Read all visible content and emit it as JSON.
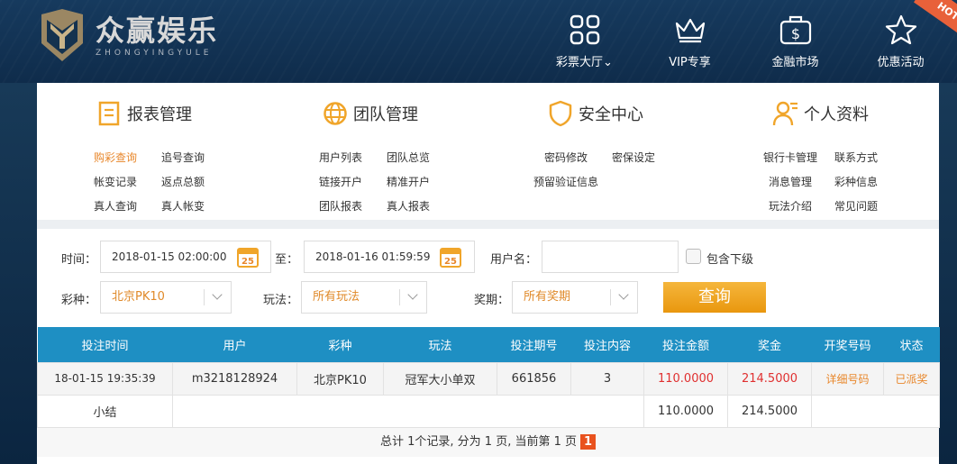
{
  "brand": {
    "name": "众赢娱乐",
    "subtitle": "ZHONGYINGYULE"
  },
  "top_nav": [
    {
      "label": "彩票大厅",
      "icon": "grid-icon",
      "has_dropdown": true
    },
    {
      "label": "VIP专享",
      "icon": "crown-icon"
    },
    {
      "label": "金融市场",
      "icon": "dollar-bag-icon"
    },
    {
      "label": "优惠活动",
      "icon": "star-icon",
      "badge": "HOT"
    }
  ],
  "menu": {
    "report": {
      "title": "报表管理",
      "links": [
        "购彩查询",
        "追号查询",
        "帐变记录",
        "返点总额",
        "真人查询",
        "真人帐变"
      ]
    },
    "team": {
      "title": "团队管理",
      "links": [
        "用户列表",
        "团队总览",
        "链接开户",
        "精准开户",
        "团队报表",
        "真人报表"
      ]
    },
    "security": {
      "title": "安全中心",
      "links": [
        "密码修改",
        "密保设定",
        "预留验证信息"
      ]
    },
    "profile": {
      "title": "个人资料",
      "links": [
        "银行卡管理",
        "联系方式",
        "消息管理",
        "彩种信息",
        "玩法介绍",
        "常见问题"
      ]
    }
  },
  "filters": {
    "time_label": "时间：",
    "start_time": "2018-01-15 02:00:00",
    "to_label": "至：",
    "end_time": "2018-01-16 01:59:59",
    "calendar_day": "25",
    "username_label": "用户名：",
    "username_value": "",
    "include_sub_label": "包含下级",
    "lottery_label": "彩种：",
    "lottery_value": "北京PK10",
    "play_label": "玩法：",
    "play_value": "所有玩法",
    "issue_label": "奖期：",
    "issue_value": "所有奖期",
    "query_button": "查询"
  },
  "table": {
    "headers": [
      "投注时间",
      "用户",
      "彩种",
      "玩法",
      "投注期号",
      "投注内容",
      "投注金额",
      "奖金",
      "开奖号码",
      "状态"
    ],
    "rows": [
      [
        "18-01-15 19:35:39",
        "m3218128924",
        "北京PK10",
        "冠军大小单双",
        "661856",
        "3",
        "110.0000",
        "214.5000",
        "详细号码",
        "已派奖"
      ]
    ],
    "summary": {
      "label": "小结",
      "amount": "110.0000",
      "bonus": "214.5000"
    }
  },
  "pager": {
    "text": "总计 1个记录, 分为 1 页, 当前第 1 页",
    "current": "1"
  },
  "colors": {
    "accent": "#e8872b",
    "header_blue": "#1e8fc3",
    "query_button": "#f0a52a",
    "amount_red": "#e03030"
  }
}
